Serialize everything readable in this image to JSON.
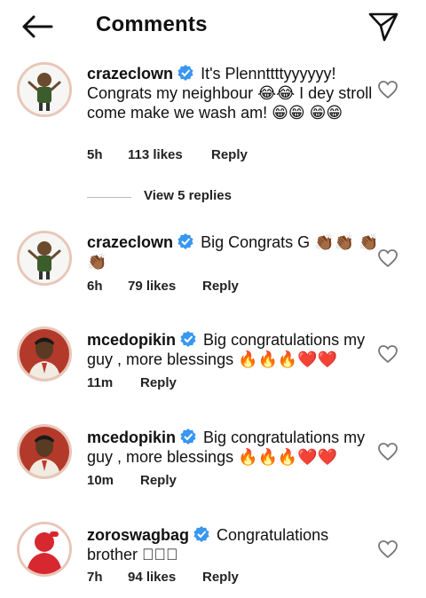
{
  "header": {
    "title": "Comments"
  },
  "comments": [
    {
      "username": "crazeclown",
      "text": "It's Plennttttyyyyyy! Congrats my neighbour 😂😂 I dey stroll come make we wash am! 😁😁 😁😁",
      "time": "5h",
      "likes": "113 likes",
      "reply": "Reply"
    },
    {
      "username": "crazeclown",
      "text": "Big Congrats G 👏🏾👏🏾 👏🏾👏🏾",
      "time": "6h",
      "likes": "79 likes",
      "reply": "Reply"
    },
    {
      "username": "mcedopikin",
      "text": "Big congratulations my guy , more blessings 🔥🔥🔥❤️❤️",
      "time": "11m",
      "reply": "Reply"
    },
    {
      "username": "mcedopikin",
      "text": "Big congratulations my guy , more blessings 🔥🔥🔥❤️❤️",
      "time": "10m",
      "reply": "Reply"
    },
    {
      "username": "zoroswagbag",
      "text": "Congratulations brother 🏻🏻🏻",
      "time": "7h",
      "likes": "94 likes",
      "reply": "Reply"
    }
  ],
  "view_replies": "View 5 replies",
  "colors": {
    "verified": "#3897f0",
    "avatar_ring": "#e8c7b8",
    "text": "#111111"
  },
  "icons": [
    "back-arrow-icon",
    "send-icon",
    "verified-badge-icon",
    "heart-icon"
  ]
}
